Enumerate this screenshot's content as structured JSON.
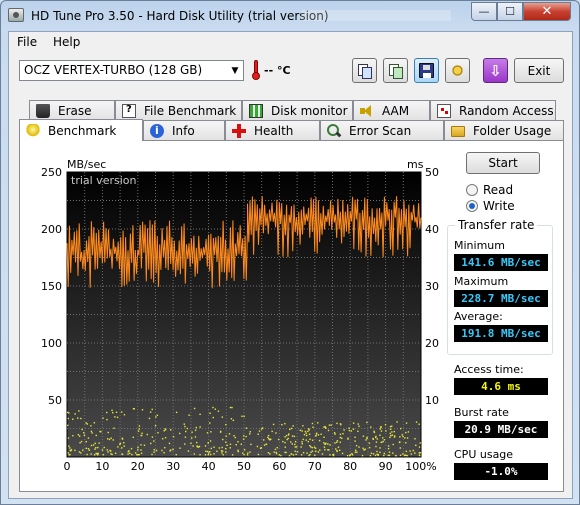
{
  "window": {
    "title": "HD Tune Pro 3.50 - Hard Disk Utility (trial version)"
  },
  "menu": {
    "file": "File",
    "help": "Help"
  },
  "toolbar": {
    "drive": "OCZ VERTEX-TURBO (128 GB)",
    "temperature": "-- °C",
    "exit": "Exit",
    "purple_glyph": "⇩"
  },
  "tabs_top": [
    {
      "label": "Erase",
      "icon": "trash-icon"
    },
    {
      "label": "File Benchmark",
      "icon": "file-benchmark-icon"
    },
    {
      "label": "Disk monitor",
      "icon": "disk-monitor-icon"
    },
    {
      "label": "AAM",
      "icon": "speaker-icon"
    },
    {
      "label": "Random Access",
      "icon": "random-access-icon"
    }
  ],
  "tabs_bottom": [
    {
      "label": "Benchmark",
      "icon": "lightbulb-icon",
      "selected": true
    },
    {
      "label": "Info",
      "icon": "info-icon"
    },
    {
      "label": "Health",
      "icon": "health-cross-icon"
    },
    {
      "label": "Error Scan",
      "icon": "magnifier-icon"
    },
    {
      "label": "Folder Usage",
      "icon": "folder-icon"
    }
  ],
  "controls": {
    "start": "Start",
    "read": "Read",
    "write": "Write",
    "mode_selected": "write"
  },
  "transfer": {
    "group_title": "Transfer rate",
    "minimum_label": "Minimum",
    "minimum": "141.6 MB/sec",
    "maximum_label": "Maximum",
    "maximum": "228.7 MB/sec",
    "average_label": "Average:",
    "average": "191.8 MB/sec"
  },
  "access": {
    "label": "Access time:",
    "value": "4.6 ms"
  },
  "burst": {
    "label": "Burst rate",
    "value": "20.9 MB/sec"
  },
  "cpu": {
    "label": "CPU usage",
    "value": "-1.0%"
  },
  "colors": {
    "transfer_line": "#ff8a1e",
    "access_points": "#e8e83a",
    "plot_bg_top": "#000000",
    "plot_bg_bottom": "#4a4a4a",
    "grid": "#707070"
  },
  "chart_data": {
    "type": "line",
    "watermark": "trial version",
    "ylabel_left": "MB/sec",
    "ylabel_right": "ms",
    "ylim_left": [
      0,
      250
    ],
    "ylim_right": [
      0,
      50
    ],
    "xlim": [
      0,
      100
    ],
    "x_ticks": [
      "0",
      "10",
      "20",
      "30",
      "40",
      "50",
      "60",
      "70",
      "80",
      "90",
      "100%"
    ],
    "y_ticks_left": [
      "250",
      "200",
      "150",
      "100",
      "50"
    ],
    "y_ticks_right": [
      "50",
      "40",
      "30",
      "20",
      "10"
    ],
    "grid": true,
    "series": [
      {
        "name": "Transfer rate",
        "axis": "left",
        "segments": [
          {
            "x_range": [
              0,
              51
            ],
            "low": 148,
            "high": 208,
            "center": 180
          },
          {
            "x_range": [
              51,
              100
            ],
            "low": 175,
            "high": 229,
            "center": 210
          }
        ]
      },
      {
        "name": "Access time",
        "axis": "right",
        "style": "scatter",
        "x_range": [
          0,
          100
        ],
        "y_range": [
          0.5,
          9
        ],
        "typical": 4.6
      }
    ]
  }
}
